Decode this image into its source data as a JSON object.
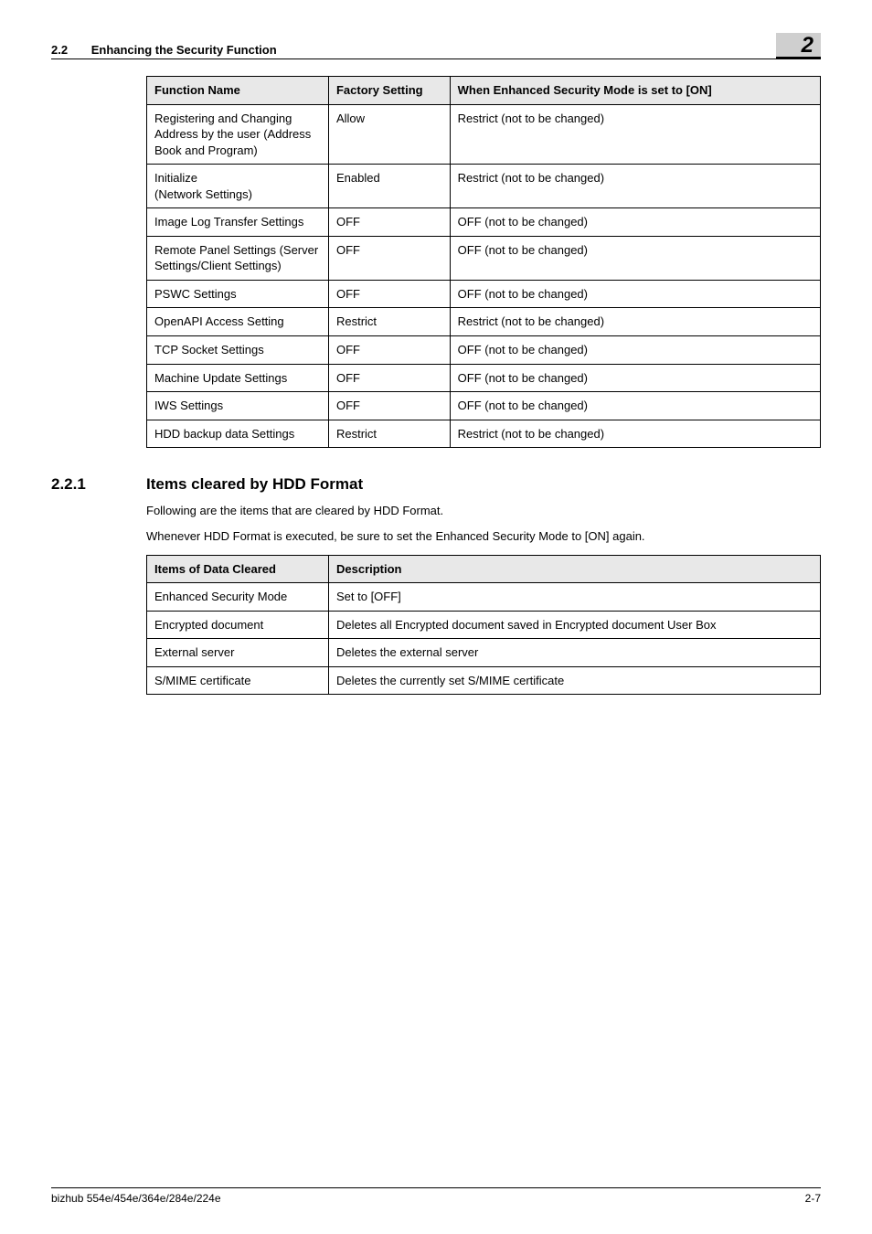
{
  "header": {
    "section_number": "2.2",
    "section_title": "Enhancing the Security Function",
    "chapter_number": "2"
  },
  "table1": {
    "headers": [
      "Function Name",
      "Factory Setting",
      "When Enhanced Security Mode is set to [ON]"
    ],
    "rows": [
      [
        "Registering and Changing Address by the user (Address Book and Program)",
        "Allow",
        "Restrict (not to be changed)"
      ],
      [
        "Initialize\n(Network Settings)",
        "Enabled",
        "Restrict (not to be changed)"
      ],
      [
        "Image Log Transfer Settings",
        "OFF",
        "OFF (not to be changed)"
      ],
      [
        "Remote Panel Settings (Server Settings/Client Settings)",
        "OFF",
        "OFF (not to be changed)"
      ],
      [
        "PSWC Settings",
        "OFF",
        "OFF (not to be changed)"
      ],
      [
        "OpenAPI Access Setting",
        "Restrict",
        "Restrict (not to be changed)"
      ],
      [
        "TCP Socket Settings",
        "OFF",
        "OFF (not to be changed)"
      ],
      [
        "Machine Update Settings",
        "OFF",
        "OFF (not to be changed)"
      ],
      [
        "IWS Settings",
        "OFF",
        "OFF (not to be changed)"
      ],
      [
        "HDD backup data Settings",
        "Restrict",
        "Restrict (not to be changed)"
      ]
    ]
  },
  "subsection": {
    "number": "2.2.1",
    "title": "Items cleared by HDD Format",
    "para1": "Following are the items that are cleared by HDD Format.",
    "para2": "Whenever HDD Format is executed, be sure to set the Enhanced Security Mode to [ON] again."
  },
  "table2": {
    "headers": [
      "Items of Data Cleared",
      "Description"
    ],
    "rows": [
      [
        "Enhanced Security Mode",
        "Set to [OFF]"
      ],
      [
        "Encrypted document",
        "Deletes all Encrypted document saved in Encrypted document User Box"
      ],
      [
        "External server",
        "Deletes the external server"
      ],
      [
        "S/MIME certificate",
        "Deletes the currently set S/MIME certificate"
      ]
    ]
  },
  "footer": {
    "left": "bizhub 554e/454e/364e/284e/224e",
    "right": "2-7"
  }
}
